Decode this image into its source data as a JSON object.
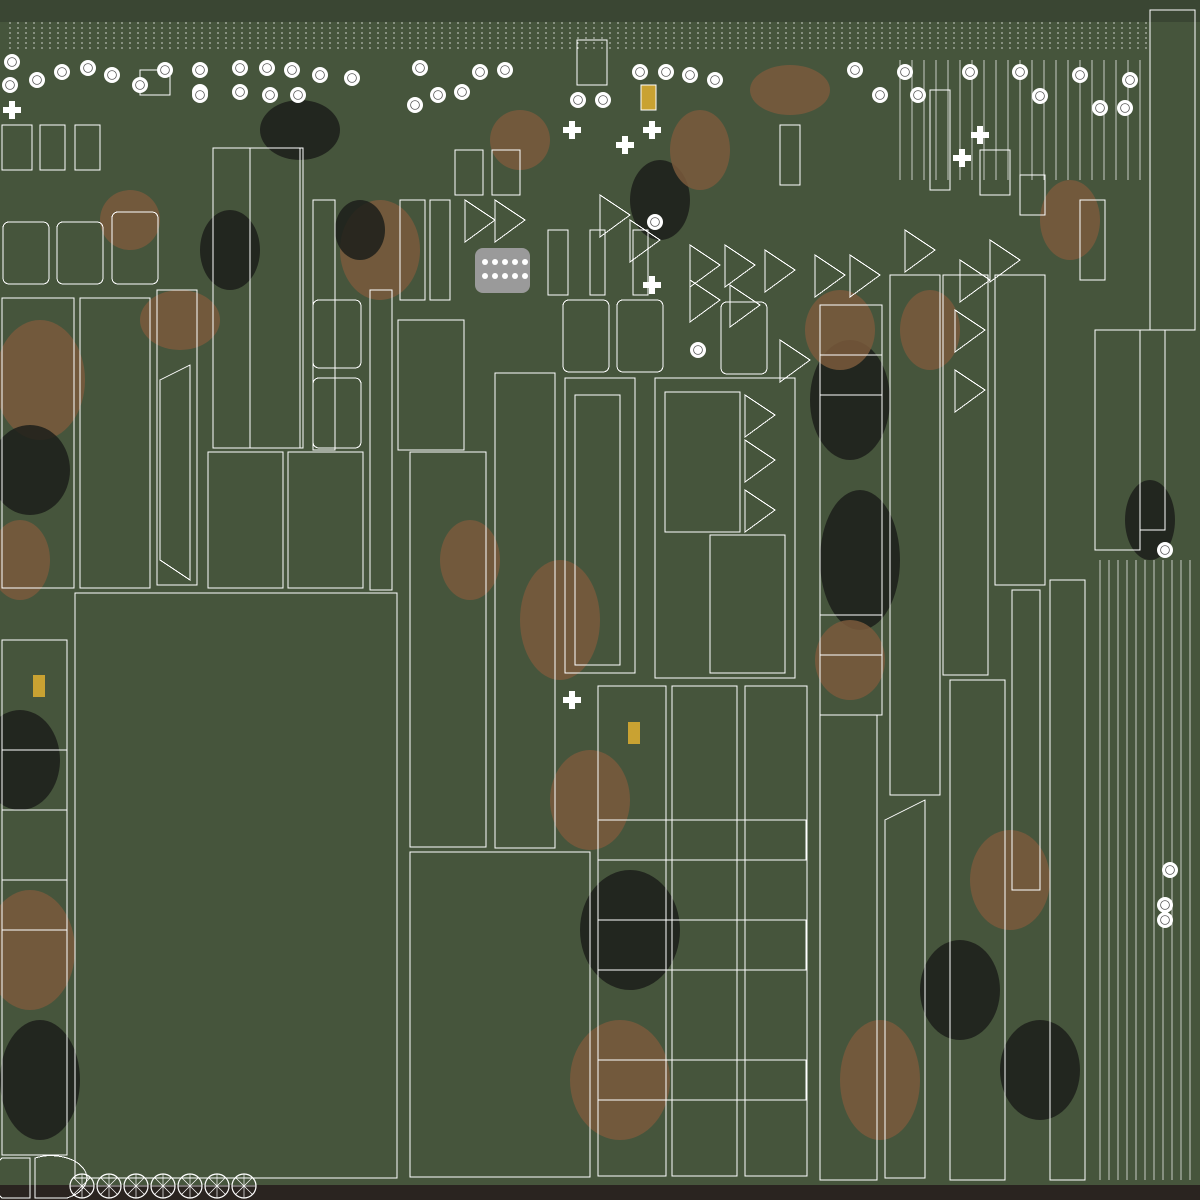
{
  "view": {
    "kind": "uv-texture-layout",
    "shows_text": false
  },
  "palette": {
    "base_green": "#46553c",
    "dark_green": "#3a4633",
    "camo_brown": "#7a5a3c",
    "camo_black": "#1c1f1a",
    "wire": "#ffffff",
    "highlight_yellow": "#c9a232",
    "bottom_strip": "#2a2420"
  },
  "icons": {
    "bolt_head": "bolt-head-icon",
    "wheel": "wheel-icon",
    "crosshair": "plus-bolt-icon",
    "grill": "grill-panel-icon"
  }
}
